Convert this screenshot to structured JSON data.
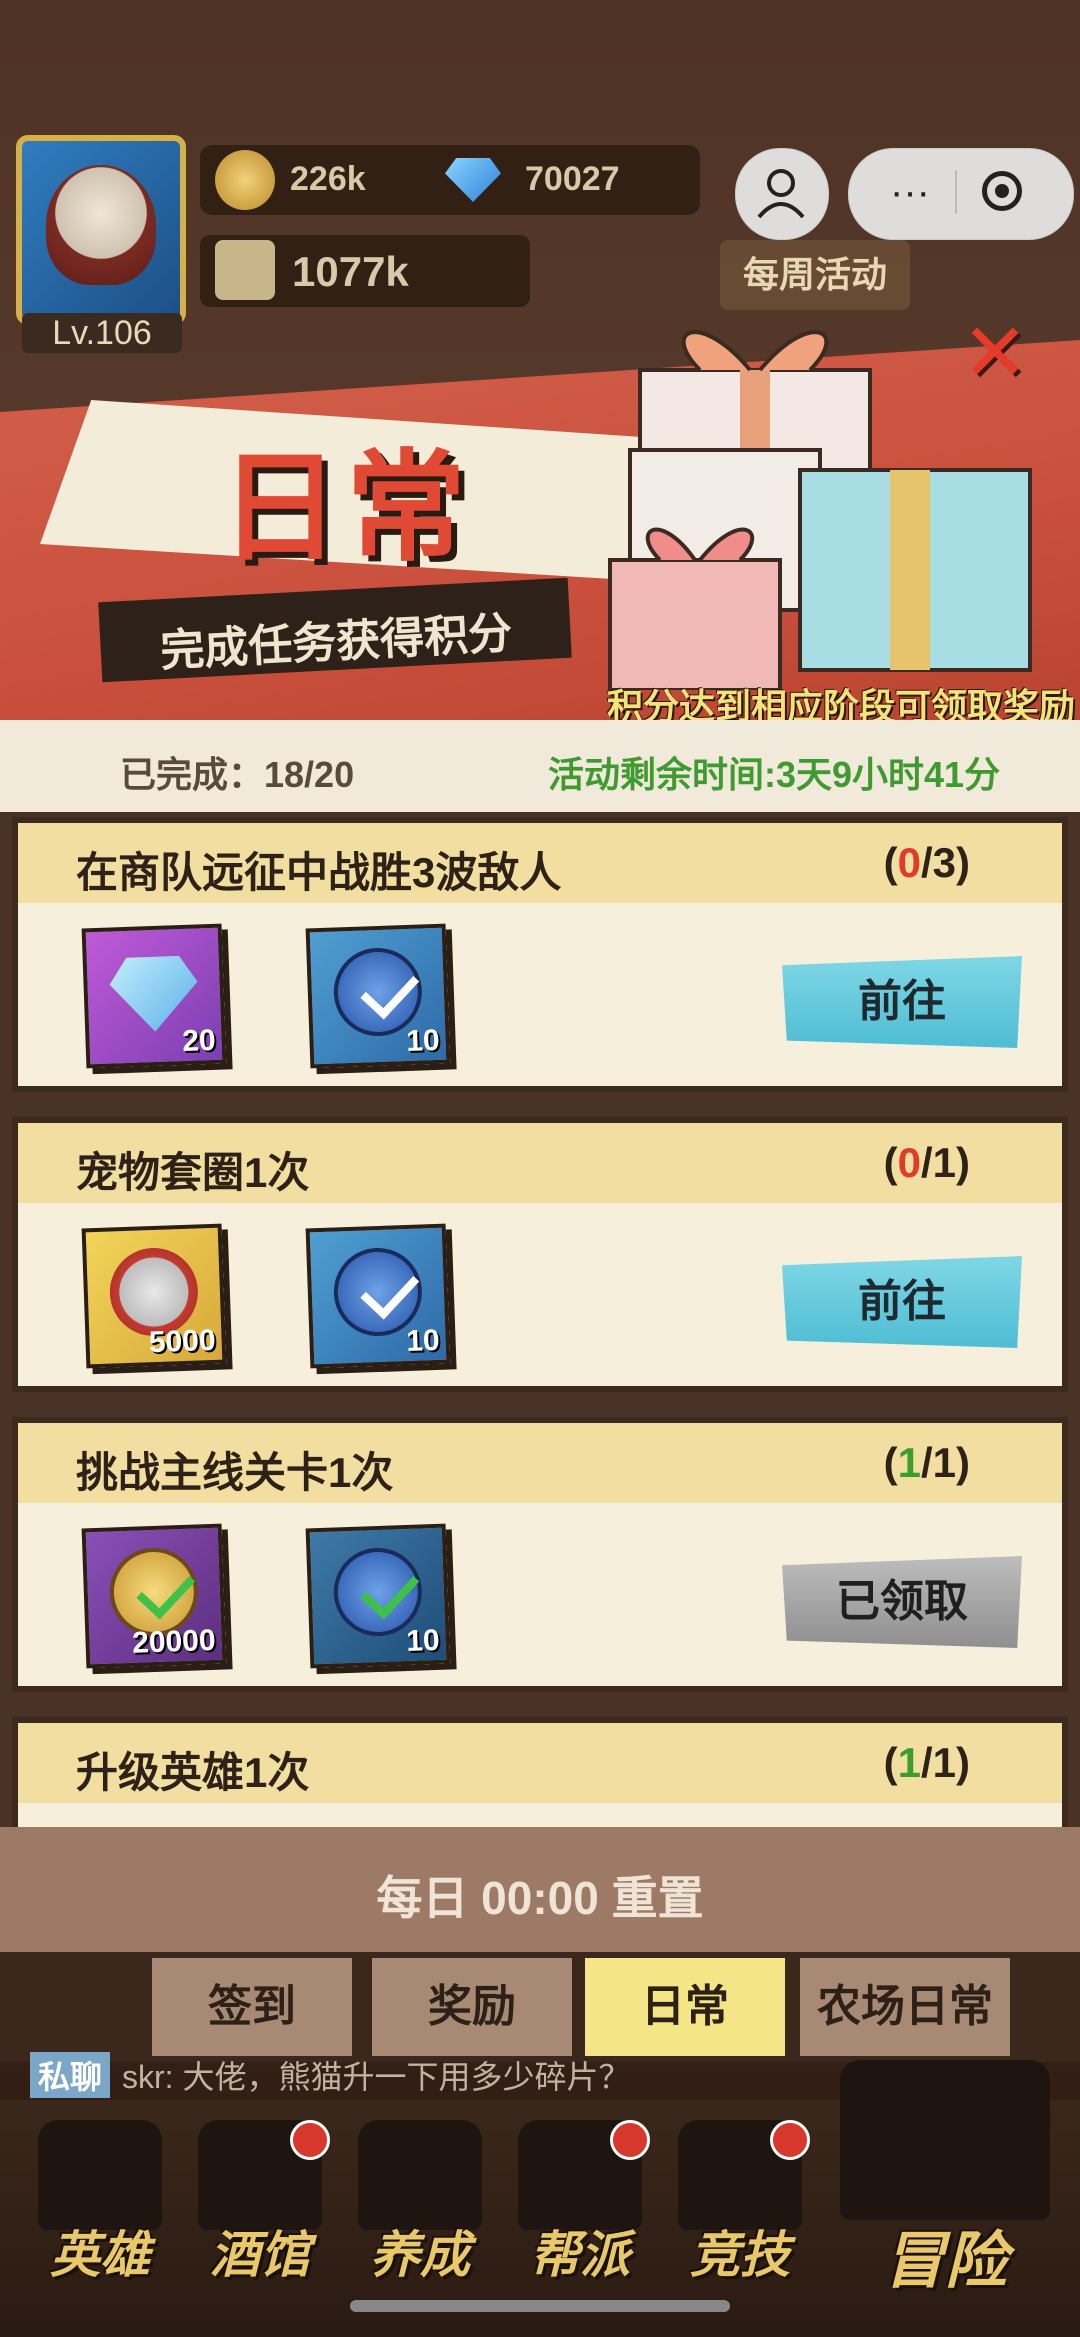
{
  "hud": {
    "level": "Lv.106",
    "coins": "226k",
    "gems": "70027",
    "power": "1077k",
    "weekly_event": "每周活动"
  },
  "banner": {
    "title": "日常",
    "subtitle": "完成任务获得积分",
    "hint": "积分达到相应阶段可领取奖励",
    "completed": "已完成：18/20",
    "remaining": "活动剩余时间:3天9小时41分"
  },
  "tasks": [
    {
      "title": "在商队远征中战胜3波敌人",
      "prog_open": "(",
      "prog_cur": "0",
      "prog_rest": "/3)",
      "prog_state": "red",
      "rewards": [
        {
          "icon": "diamond-icon",
          "count": "20"
        },
        {
          "icon": "check-coin-icon",
          "count": "10"
        }
      ],
      "action": "前往"
    },
    {
      "title": "宠物套圈1次",
      "prog_open": "(",
      "prog_cur": "0",
      "prog_rest": "/1)",
      "prog_state": "red",
      "rewards": [
        {
          "icon": "can-icon",
          "count": "5000"
        },
        {
          "icon": "check-coin-icon",
          "count": "10"
        }
      ],
      "action": "前往"
    },
    {
      "title": "挑战主线关卡1次",
      "prog_open": "(",
      "prog_cur": "1",
      "prog_rest": "/1)",
      "prog_state": "green",
      "rewards": [
        {
          "icon": "gold-coin-icon",
          "count": "20000"
        },
        {
          "icon": "check-coin-icon",
          "count": "10"
        }
      ],
      "action": "已领取"
    },
    {
      "title": "升级英雄1次",
      "prog_open": "(",
      "prog_cur": "1",
      "prog_rest": "/1)",
      "prog_state": "green"
    }
  ],
  "reset_text": "每日 00:00 重置",
  "tabs": [
    "签到",
    "奖励",
    "日常",
    "农场日常"
  ],
  "active_tab": "日常",
  "chat": {
    "tag": "私聊",
    "message": "skr: 大佬，熊猫升一下用多少碎片？"
  },
  "nav": [
    "英雄",
    "酒馆",
    "养成",
    "帮派",
    "竞技",
    "冒险"
  ],
  "colors": {
    "accent_red": "#e04a34",
    "go_button": "#4fbdd4",
    "claimed_button": "#8f8f8f",
    "active_tab": "#f4e686"
  }
}
